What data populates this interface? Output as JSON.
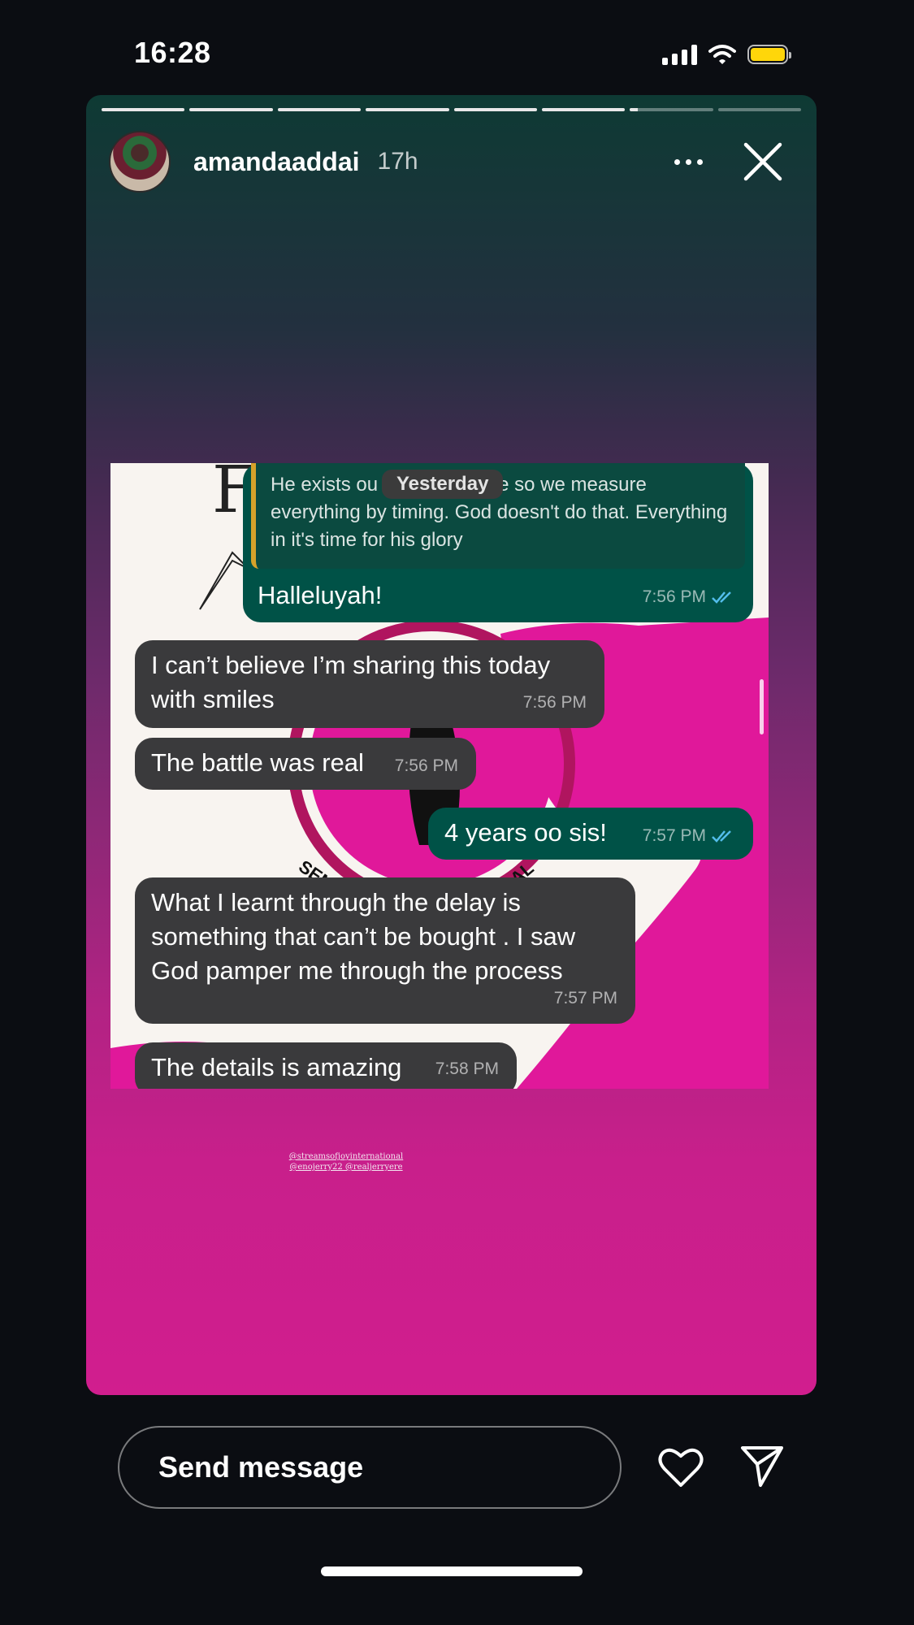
{
  "status_bar": {
    "time": "16:28",
    "battery_color": "#ffd60a"
  },
  "story": {
    "username": "amandaaddai",
    "time_ago": "17h",
    "progress": {
      "segments": 8,
      "completed": 6,
      "current_fraction": 0.1
    },
    "icons": {
      "more": "more-horizontal-icon",
      "close": "close-icon"
    }
  },
  "chat": {
    "date_chip": "Yesterday",
    "quoted_text": "He exists ou  are within time so we measure everything by timing. God doesn't do that. Everything in it's time for his glory",
    "messages": [
      {
        "dir": "out",
        "text": "Halleluyah!",
        "time": "7:56 PM",
        "read": true
      },
      {
        "dir": "in",
        "text": "I can’t believe I’m sharing this today with smiles",
        "time": "7:56 PM"
      },
      {
        "dir": "in",
        "text": "The battle was real",
        "time": "7:56 PM"
      },
      {
        "dir": "out",
        "text": "4 years oo sis!",
        "time": "7:57 PM",
        "read": true
      },
      {
        "dir": "in",
        "text": "What I learnt through the delay is something that can’t be bought . I saw God pamper me through the process",
        "time": "7:57 PM"
      },
      {
        "dir": "in",
        "text": "The details is amazing",
        "time": "7:58 PM"
      }
    ]
  },
  "mentions": [
    "@streamsofjoyinternational",
    "@enojerry22 @realjerryere"
  ],
  "reply": {
    "placeholder": "Send message",
    "icons": {
      "like": "heart-icon",
      "send": "send-icon"
    }
  }
}
